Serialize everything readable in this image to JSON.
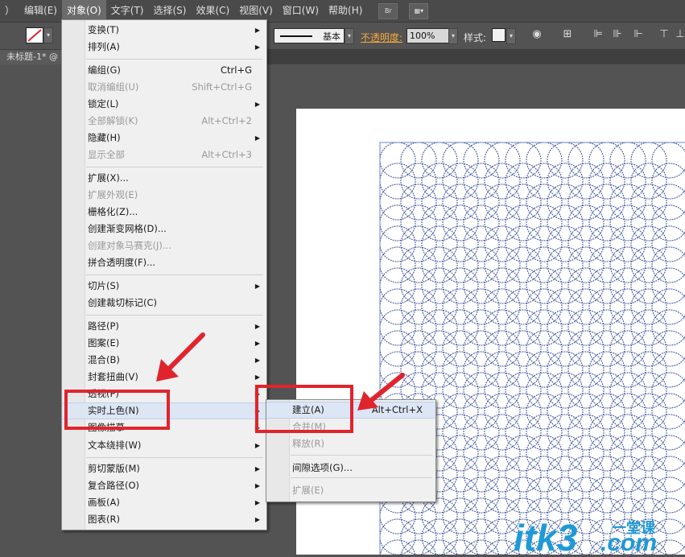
{
  "menubar": {
    "items": [
      {
        "label": "）"
      },
      {
        "label": "编辑(E)"
      },
      {
        "label": "对象(O)"
      },
      {
        "label": "文字(T)"
      },
      {
        "label": "选择(S)"
      },
      {
        "label": "效果(C)"
      },
      {
        "label": "视图(V)"
      },
      {
        "label": "窗口(W)"
      },
      {
        "label": "帮助(H)"
      }
    ],
    "bridge_icon": "Br"
  },
  "control_bar": {
    "stroke_label": "基本",
    "opacity_label": "不透明度:",
    "opacity_value": "100%",
    "style_label": "样式:"
  },
  "document_tab": {
    "label": "未标题-1* @"
  },
  "object_menu": {
    "items": [
      {
        "label": "变换(T)",
        "shortcut": "",
        "submenu": true,
        "disabled": false
      },
      {
        "label": "排列(A)",
        "shortcut": "",
        "submenu": true,
        "disabled": false
      },
      {
        "label": "编组(G)",
        "shortcut": "Ctrl+G",
        "submenu": false,
        "disabled": false
      },
      {
        "label": "取消编组(U)",
        "shortcut": "Shift+Ctrl+G",
        "submenu": false,
        "disabled": true
      },
      {
        "label": "锁定(L)",
        "shortcut": "",
        "submenu": true,
        "disabled": false
      },
      {
        "label": "全部解锁(K)",
        "shortcut": "Alt+Ctrl+2",
        "submenu": false,
        "disabled": true
      },
      {
        "label": "隐藏(H)",
        "shortcut": "",
        "submenu": true,
        "disabled": false
      },
      {
        "label": "显示全部",
        "shortcut": "Alt+Ctrl+3",
        "submenu": false,
        "disabled": true
      },
      {
        "label": "扩展(X)...",
        "shortcut": "",
        "submenu": false,
        "disabled": false
      },
      {
        "label": "扩展外观(E)",
        "shortcut": "",
        "submenu": false,
        "disabled": true
      },
      {
        "label": "栅格化(Z)...",
        "shortcut": "",
        "submenu": false,
        "disabled": false
      },
      {
        "label": "创建渐变网格(D)...",
        "shortcut": "",
        "submenu": false,
        "disabled": false
      },
      {
        "label": "创建对象马赛克(J)...",
        "shortcut": "",
        "submenu": false,
        "disabled": true
      },
      {
        "label": "拼合透明度(F)...",
        "shortcut": "",
        "submenu": false,
        "disabled": false
      },
      {
        "label": "切片(S)",
        "shortcut": "",
        "submenu": true,
        "disabled": false
      },
      {
        "label": "创建裁切标记(C)",
        "shortcut": "",
        "submenu": false,
        "disabled": false
      },
      {
        "label": "路径(P)",
        "shortcut": "",
        "submenu": true,
        "disabled": false
      },
      {
        "label": "图案(E)",
        "shortcut": "",
        "submenu": true,
        "disabled": false
      },
      {
        "label": "混合(B)",
        "shortcut": "",
        "submenu": true,
        "disabled": false
      },
      {
        "label": "封套扭曲(V)",
        "shortcut": "",
        "submenu": true,
        "disabled": false
      },
      {
        "label": "透视(P)",
        "shortcut": "",
        "submenu": true,
        "disabled": false
      },
      {
        "label": "实时上色(N)",
        "shortcut": "",
        "submenu": true,
        "disabled": false
      },
      {
        "label": "图像描摹",
        "shortcut": "",
        "submenu": true,
        "disabled": false
      },
      {
        "label": "文本绕排(W)",
        "shortcut": "",
        "submenu": true,
        "disabled": false
      },
      {
        "label": "剪切蒙版(M)",
        "shortcut": "",
        "submenu": true,
        "disabled": false
      },
      {
        "label": "复合路径(O)",
        "shortcut": "",
        "submenu": true,
        "disabled": false
      },
      {
        "label": "画板(A)",
        "shortcut": "",
        "submenu": true,
        "disabled": false
      },
      {
        "label": "图表(R)",
        "shortcut": "",
        "submenu": true,
        "disabled": false
      }
    ],
    "highlighted": "实时上色(N)"
  },
  "live_paint_submenu": {
    "items": [
      {
        "label": "建立(A)",
        "shortcut": "Alt+Ctrl+X",
        "disabled": false
      },
      {
        "label": "合并(M)",
        "shortcut": "",
        "disabled": true
      },
      {
        "label": "释放(R)",
        "shortcut": "",
        "disabled": true
      },
      {
        "label": "间隙选项(G)...",
        "shortcut": "",
        "disabled": false
      },
      {
        "label": "扩展(E)",
        "shortcut": "",
        "disabled": true
      }
    ],
    "highlighted": "建立(A)"
  },
  "watermark": {
    "text": "itk3",
    "suffix": ".com",
    "cn": "一堂课"
  },
  "colors": {
    "accent_red": "#e0242d",
    "circle_blue": "#3a4f9a",
    "menu_bg": "#f0f0f0",
    "ui_dark": "#535353"
  }
}
